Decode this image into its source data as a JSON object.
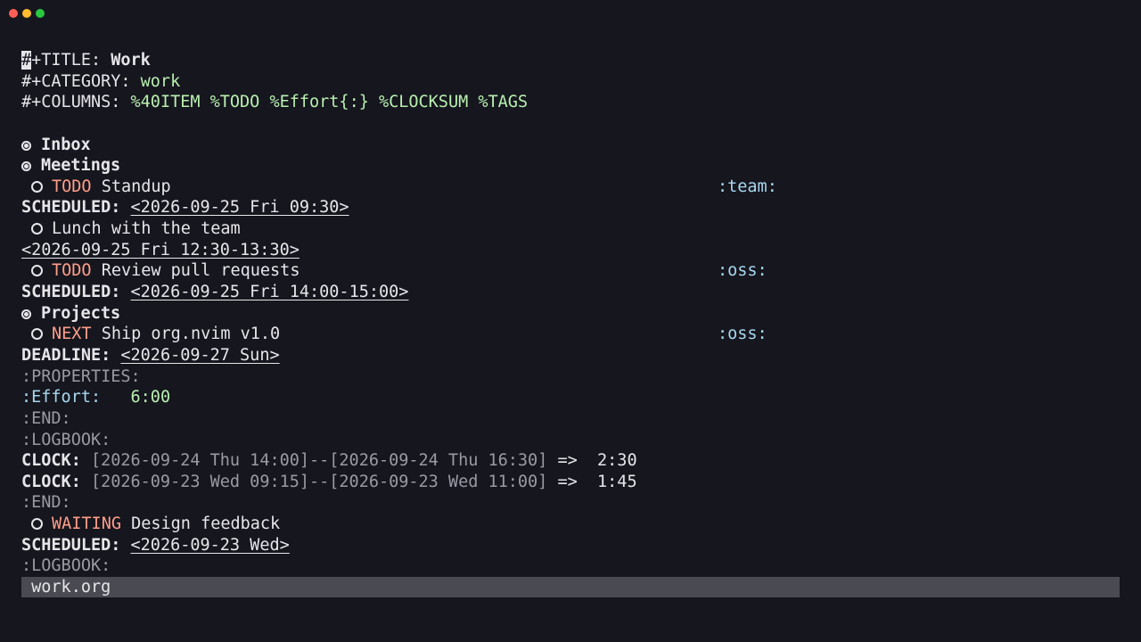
{
  "window": {
    "title": ""
  },
  "header": {
    "title_key": "+TITLE: ",
    "title_hash": "#",
    "title_value": "Work",
    "category_key": "#+CATEGORY: ",
    "category_value": "work",
    "columns_key": "#+COLUMNS: ",
    "columns_value": "%40ITEM %TODO %Effort{:} %CLOCKSUM %TAGS"
  },
  "headings": {
    "inbox": "Inbox",
    "meetings": "Meetings",
    "projects": "Projects"
  },
  "items": {
    "standup": {
      "keyword": "TODO",
      "title": " Standup",
      "tag": ":team:",
      "scheduled_label": "SCHEDULED:",
      "scheduled_date": "<2026-09-25 Fri 09:30>"
    },
    "lunch": {
      "title": "Lunch with the team",
      "date": "<2026-09-25 Fri 12:30-13:30>"
    },
    "review": {
      "keyword": "TODO",
      "title": " Review pull requests",
      "tag": ":oss:",
      "scheduled_label": "SCHEDULED:",
      "scheduled_date": "<2026-09-25 Fri 14:00-15:00>"
    },
    "ship": {
      "keyword": "NEXT",
      "title": " Ship org.nvim v1.0",
      "tag": ":oss:",
      "deadline_label": "DEADLINE:",
      "deadline_date": "<2026-09-27 Sun>",
      "properties_start": ":PROPERTIES:",
      "effort_key": ":Effort:",
      "effort_value": "6:00",
      "properties_end": ":END:",
      "logbook_start": ":LOGBOOK:",
      "clock_label": "CLOCK:",
      "clock_entries": [
        {
          "range": "[2026-09-24 Thu 14:00]--[2026-09-24 Thu 16:30]",
          "arrow": "=>",
          "duration": "2:30"
        },
        {
          "range": "[2026-09-23 Wed 09:15]--[2026-09-23 Wed 11:00]",
          "arrow": "=>",
          "duration": "1:45"
        }
      ],
      "logbook_end": ":END:"
    },
    "design": {
      "keyword": "WAITING",
      "title": " Design feedback",
      "scheduled_label": "SCHEDULED:",
      "scheduled_date": "<2026-09-23 Wed>",
      "logbook_start": ":LOGBOOK:"
    }
  },
  "statusbar": {
    "filename": "work.org"
  },
  "colors": {
    "background": "#16161e",
    "foreground": "#e6e6ea",
    "green": "#b8f0b0",
    "todo": "#ff9e8a",
    "tag": "#a8d8f0",
    "dim": "#9a9aa4",
    "statusbar": "#4a4a52"
  }
}
